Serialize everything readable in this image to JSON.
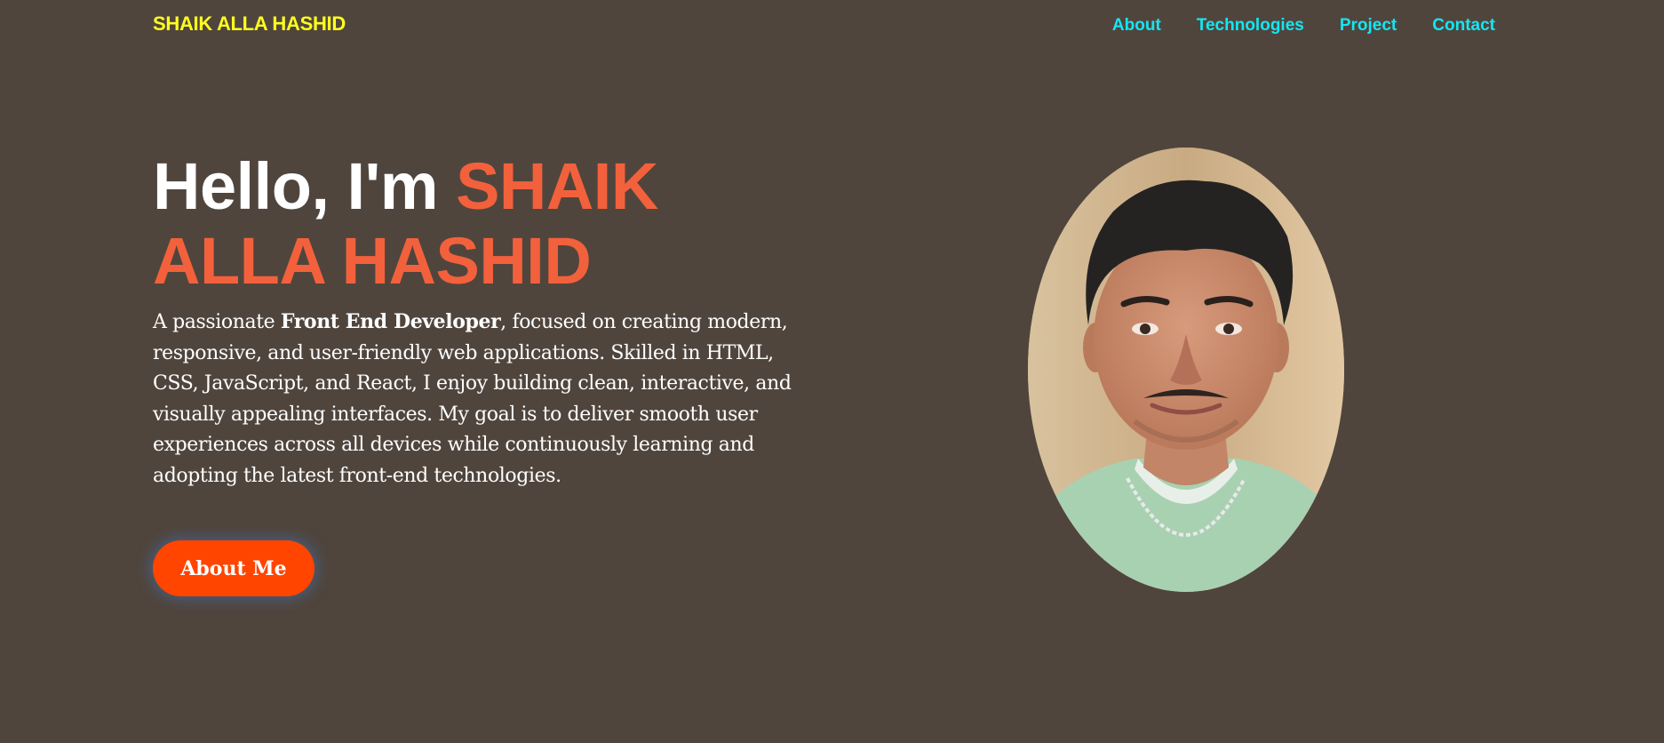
{
  "header": {
    "brand": "SHAIK ALLA HASHID",
    "nav": [
      "About",
      "Technologies",
      "Project",
      "Contact"
    ]
  },
  "hero": {
    "greeting": "Hello, I'm ",
    "name": "SHAIK ALLA HASHID",
    "description": {
      "before": "A passionate ",
      "highlight": "Front End Developer",
      "after": ", focused on creating modern, responsive, and user-friendly web applications. Skilled in HTML, CSS, JavaScript, and React, I enjoy building clean, interactive, and visually appealing interfaces. My goal is to deliver smooth user experiences across all devices while continuously learning and adopting the latest front-end technologies."
    },
    "cta": "About Me"
  },
  "colors": {
    "background": "#50453d",
    "brand": "#ffff1f",
    "nav": "#14e6f2",
    "accent": "#f2613c",
    "button": "#ff4500"
  }
}
